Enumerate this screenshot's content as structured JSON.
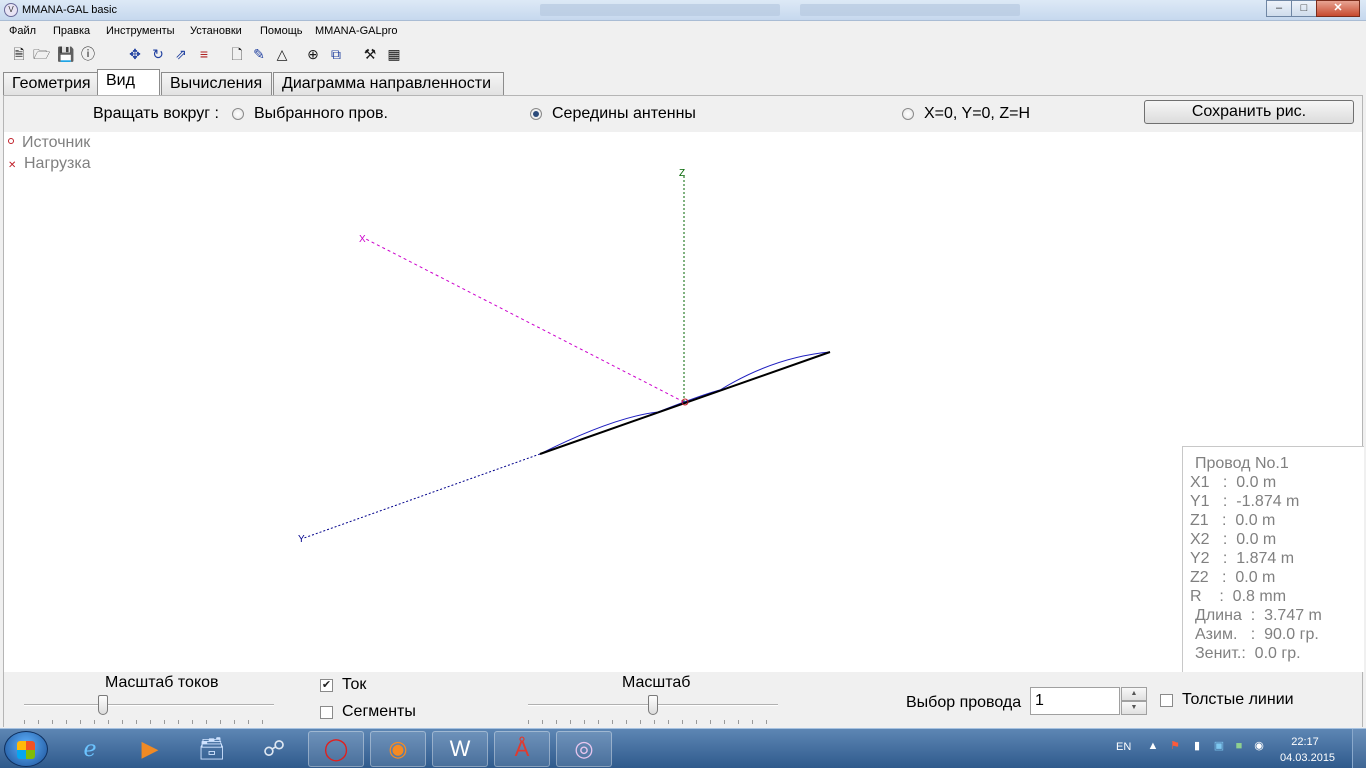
{
  "window": {
    "title": "MMANA-GAL basic",
    "min": "–",
    "max": "□",
    "close": "✕"
  },
  "menu": [
    "Файл",
    "Правка",
    "Инструменты",
    "Установки",
    "Помощь",
    "MMANA-GALpro"
  ],
  "tabs": [
    "Геометрия",
    "Вид",
    "Вычисления",
    "Диаграмма направленности"
  ],
  "active_tab": "Вид",
  "rotate": {
    "label": "Вращать вокруг :",
    "options": [
      "Выбранного пров.",
      "Середины антенны",
      "X=0, Y=0, Z=H"
    ],
    "selected": "Середины антенны"
  },
  "save_button": "Сохранить рис.",
  "legend": {
    "source": "Источник",
    "load": "Нагрузка"
  },
  "axes": {
    "x": "X",
    "y": "Y",
    "z": "Z"
  },
  "wire_info": {
    "title": "Провод No.1",
    "x1": "X1   :  0.0 m",
    "y1": "Y1   :  -1.874 m",
    "z1": "Z1   :  0.0 m",
    "x2": "X2   :  0.0 m",
    "y2": "Y2   :  1.874 m",
    "z2": "Z2   :  0.0 m",
    "r": "R    :  0.8 mm",
    "length": "Длина  :  3.747 m",
    "azimuth": "Азим.   :  90.0 гр.",
    "zenith": "Зенит.:  0.0 гр."
  },
  "bottom": {
    "current_scale_label": "Масштаб токов",
    "current_scale_value": 0.31,
    "current_checkbox": "Ток",
    "current_checked": true,
    "segments_checkbox": "Сегменты",
    "segments_checked": false,
    "scale_label": "Масштаб",
    "scale_value": 0.5,
    "wire_select_label": "Выбор провода",
    "wire_select_value": "1",
    "thick_lines": "Толстые линии",
    "thick_checked": false
  },
  "colors": {
    "x_axis": "#cc00cc",
    "y_axis": "#00008b",
    "z_axis": "#006400",
    "current": "#2020c0",
    "wire": "#000000",
    "marker": "#c0202a"
  },
  "taskbar": {
    "lang": "EN",
    "time": "22:17",
    "date": "04.03.2015",
    "apps": [
      "internet-explorer-icon",
      "media-player-icon",
      "files-icon",
      "network-icon",
      "opera-icon",
      "firefox-icon",
      "word-icon",
      "acrobat-icon",
      "mmana-icon"
    ]
  }
}
